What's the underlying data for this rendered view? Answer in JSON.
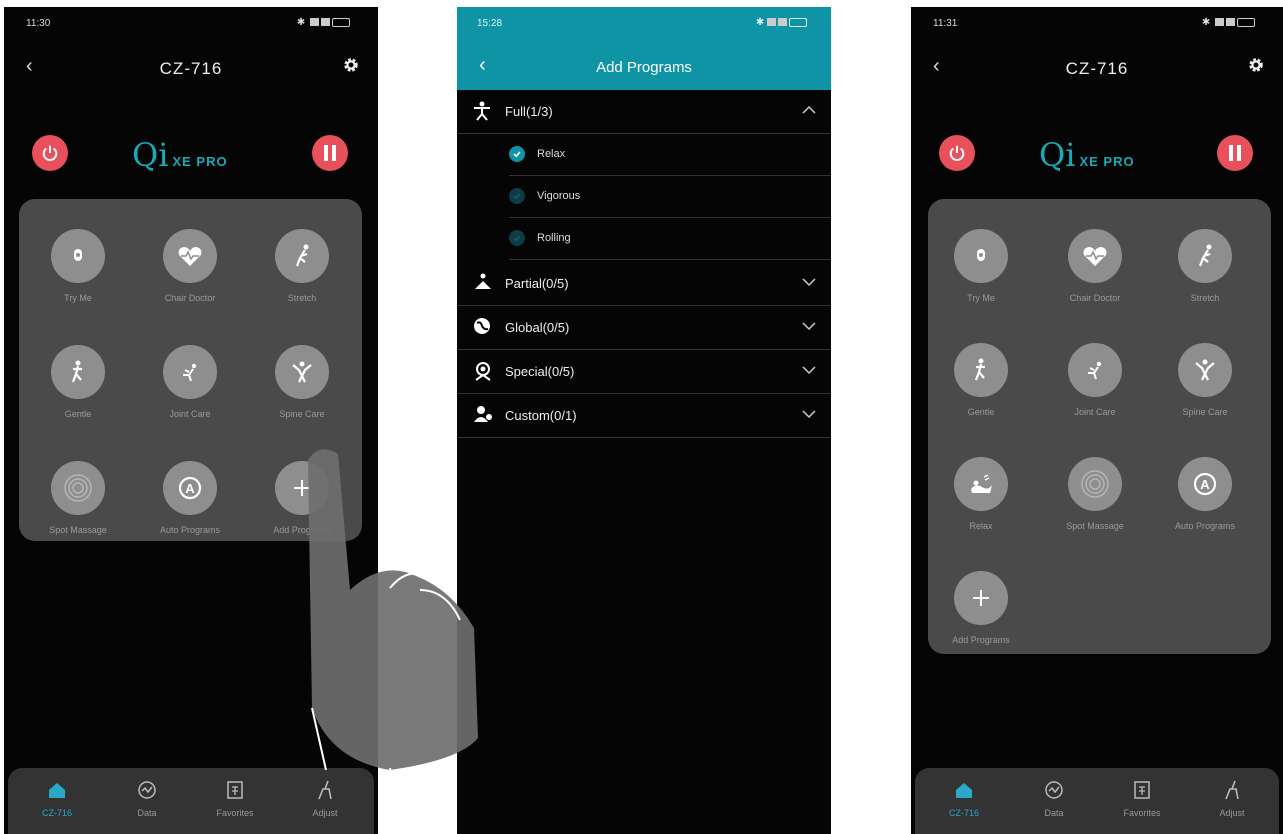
{
  "screens": {
    "before": {
      "status_time": "11:30",
      "title": "CZ-716",
      "logo_main": "Qi",
      "logo_sub": "XE PRO",
      "tiles": [
        {
          "label": "Try Me",
          "icon": "hand-icon"
        },
        {
          "label": "Chair Doctor",
          "icon": "heart-icon"
        },
        {
          "label": "Stretch",
          "icon": "stretch-icon"
        },
        {
          "label": "Gentle",
          "icon": "gentle-icon"
        },
        {
          "label": "Joint Care",
          "icon": "joint-icon"
        },
        {
          "label": "Spine Care",
          "icon": "spine-icon"
        },
        {
          "label": "Spot Massage",
          "icon": "spot-icon"
        },
        {
          "label": "Auto Programs",
          "icon": "auto-icon"
        },
        {
          "label": "Add Programs",
          "icon": "plus-icon"
        }
      ],
      "nav": [
        {
          "label": "CZ-716",
          "icon": "home-icon"
        },
        {
          "label": "Data",
          "icon": "data-icon"
        },
        {
          "label": "Favorites",
          "icon": "favorites-icon"
        },
        {
          "label": "Adjust",
          "icon": "adjust-icon"
        }
      ]
    },
    "add_programs": {
      "status_time": "15:28",
      "title": "Add Programs",
      "categories": [
        {
          "label": "Full(1/3)",
          "icon": "full-body-icon",
          "expanded": true,
          "items": [
            {
              "label": "Relax",
              "checked": true
            },
            {
              "label": "Vigorous",
              "checked": false
            },
            {
              "label": "Rolling",
              "checked": false
            }
          ]
        },
        {
          "label": "Partial(0/5)",
          "icon": "partial-icon",
          "expanded": false
        },
        {
          "label": "Global(0/5)",
          "icon": "globe-icon",
          "expanded": false
        },
        {
          "label": "Special(0/5)",
          "icon": "special-icon",
          "expanded": false
        },
        {
          "label": "Custom(0/1)",
          "icon": "custom-icon",
          "expanded": false
        }
      ]
    },
    "after": {
      "status_time": "11:31",
      "title": "CZ-716",
      "logo_main": "Qi",
      "logo_sub": "XE PRO",
      "tiles": [
        {
          "label": "Try Me",
          "icon": "hand-icon"
        },
        {
          "label": "Chair Doctor",
          "icon": "heart-icon"
        },
        {
          "label": "Stretch",
          "icon": "stretch-icon"
        },
        {
          "label": "Gentle",
          "icon": "gentle-icon"
        },
        {
          "label": "Joint Care",
          "icon": "joint-icon"
        },
        {
          "label": "Spine Care",
          "icon": "spine-icon"
        },
        {
          "label": "Relax",
          "icon": "relax-icon"
        },
        {
          "label": "Spot Massage",
          "icon": "spot-icon"
        },
        {
          "label": "Auto Programs",
          "icon": "auto-icon"
        },
        {
          "label": "Add Programs",
          "icon": "plus-icon"
        }
      ],
      "nav": [
        {
          "label": "CZ-716",
          "icon": "home-icon"
        },
        {
          "label": "Data",
          "icon": "data-icon"
        },
        {
          "label": "Favorites",
          "icon": "favorites-icon"
        },
        {
          "label": "Adjust",
          "icon": "adjust-icon"
        }
      ]
    }
  },
  "colors": {
    "accent": "#0f94a6",
    "danger": "#e8505b",
    "panel": "#4a4a4a",
    "tile": "#8e8e8e",
    "background": "#050505"
  }
}
